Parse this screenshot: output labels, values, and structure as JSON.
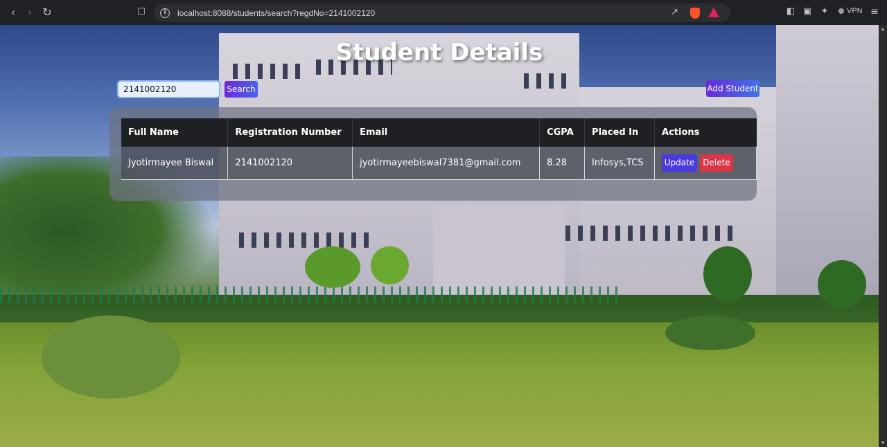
{
  "browser": {
    "url": "localhost:8088/students/search?regdNo=2141002120",
    "vpn_label": "VPN",
    "icons": [
      "back-icon",
      "forward-icon",
      "reload-icon",
      "bookmark-icon",
      "info-icon",
      "share-icon",
      "brave-shield-icon",
      "brave-rewards-icon",
      "sidebar-icon",
      "wallet-icon",
      "leo-ai-icon",
      "menu-icon"
    ]
  },
  "page": {
    "title": "Student Details",
    "search": {
      "value": "2141002120",
      "button_label": "Search"
    },
    "add_button_label": "Add Student"
  },
  "table": {
    "headers": [
      "Full Name",
      "Registration Number",
      "Email",
      "CGPA",
      "Placed In",
      "Actions"
    ],
    "rows": [
      {
        "full_name": "Jyotirmayee Biswal",
        "registration_number": "2141002120",
        "email": "jyotirmayeebiswal7381@gmail.com",
        "cgpa": "8.28",
        "placed_in": "Infosys,TCS",
        "update_label": "Update",
        "delete_label": "Delete"
      }
    ]
  },
  "colors": {
    "button_gradient_start": "#6a2bd9",
    "button_gradient_end": "#4a63e8",
    "delete": "#dc3545",
    "table_header": "#1f2023"
  }
}
